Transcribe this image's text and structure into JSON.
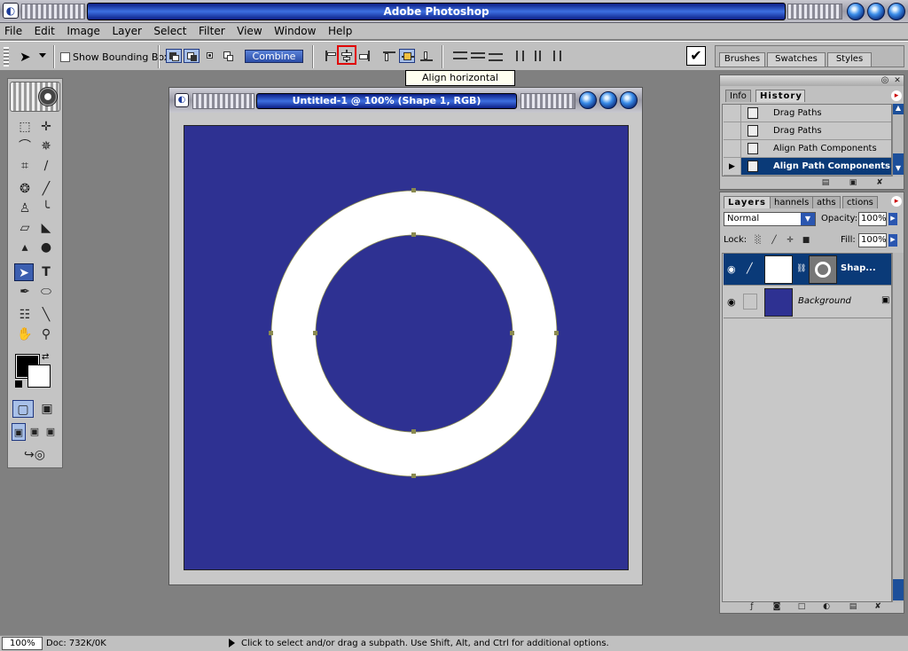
{
  "app": {
    "title": "Adobe Photoshop"
  },
  "menu": [
    "File",
    "Edit",
    "Image",
    "Layer",
    "Select",
    "Filter",
    "View",
    "Window",
    "Help"
  ],
  "options": {
    "show_bounding_box_label": "Show Bounding Box",
    "show_bounding_box_checked": false,
    "combine_label": "Combine",
    "tooltip": "Align horizontal centers"
  },
  "palette_well": {
    "tabs": [
      "Brushes",
      "Swatches",
      "Styles"
    ]
  },
  "document": {
    "title": "Untitled-1 @ 100% (Shape 1, RGB)",
    "canvas_color": "#2e3192",
    "shape_color": "#ffffff"
  },
  "history_panel": {
    "tabs": [
      "Info",
      "History"
    ],
    "items": [
      {
        "label": "Drag Paths"
      },
      {
        "label": "Drag Paths"
      },
      {
        "label": "Align Path Components"
      },
      {
        "label": "Align Path Components"
      }
    ]
  },
  "layers_panel": {
    "tabs": [
      "Layers",
      "Channels",
      "Paths",
      "Actions"
    ],
    "tab_visible": [
      "Layers",
      "hannels",
      "aths",
      "ctions"
    ],
    "blend_mode": "Normal",
    "opacity_label": "Opacity:",
    "opacity": "100%",
    "lock_label": "Lock:",
    "fill_label": "Fill:",
    "fill": "100%",
    "layers": [
      {
        "name": "Shap...",
        "selected": true
      },
      {
        "name": "Background",
        "selected": false
      }
    ]
  },
  "status": {
    "zoom": "100%",
    "doc": "Doc: 732K/0K",
    "message": "Click to select and/or drag a subpath.  Use Shift, Alt, and Ctrl for additional options."
  },
  "colors": {
    "foreground": "#000000",
    "background": "#ffffff",
    "title_accent": "#1a3fb0",
    "selection": "#0a3a78"
  }
}
